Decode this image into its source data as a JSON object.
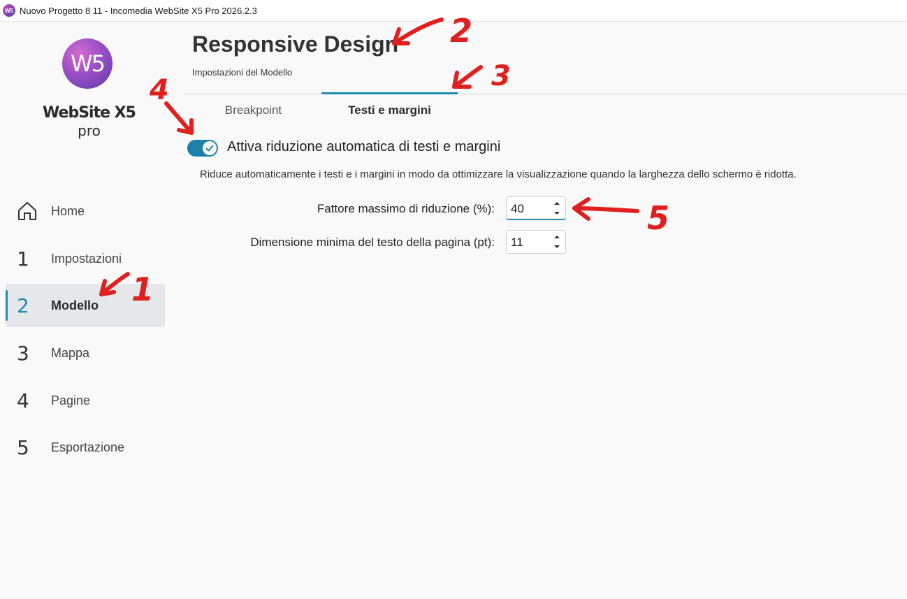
{
  "window": {
    "title": "Nuovo Progetto 8 11 - Incomedia WebSite X5 Pro 2026.2.3",
    "icon": "websitex5-app-icon"
  },
  "logo": {
    "mark": "W5",
    "name": "WebSite X5",
    "edition": "pro"
  },
  "sidebar": {
    "items": [
      {
        "num": "",
        "label": "Home",
        "icon": "home-icon"
      },
      {
        "num": "1",
        "label": "Impostazioni"
      },
      {
        "num": "2",
        "label": "Modello",
        "active": true
      },
      {
        "num": "3",
        "label": "Mappa"
      },
      {
        "num": "4",
        "label": "Pagine"
      },
      {
        "num": "5",
        "label": "Esportazione"
      }
    ]
  },
  "header": {
    "title": "Responsive Design",
    "subtitle": "Impostazioni del Modello"
  },
  "tabs": [
    {
      "label": "Breakpoint",
      "active": false
    },
    {
      "label": "Testi e margini",
      "active": true
    }
  ],
  "content": {
    "toggle": {
      "label": "Attiva riduzione automatica di testi e margini",
      "on": true
    },
    "description": "Riduce automaticamente i testi e i margini in modo da ottimizzare la visualizzazione quando la larghezza dello schermo è ridotta.",
    "fields": [
      {
        "label": "Fattore massimo di riduzione (%):",
        "value": "40"
      },
      {
        "label": "Dimensione minima del testo della pagina (pt):",
        "value": "11"
      }
    ]
  },
  "annotations": [
    "1",
    "2",
    "3",
    "4",
    "5"
  ],
  "colors": {
    "accent": "#1e8bb3",
    "annotation": "#e0201f",
    "active_nav_bg": "#e5e7ea"
  }
}
